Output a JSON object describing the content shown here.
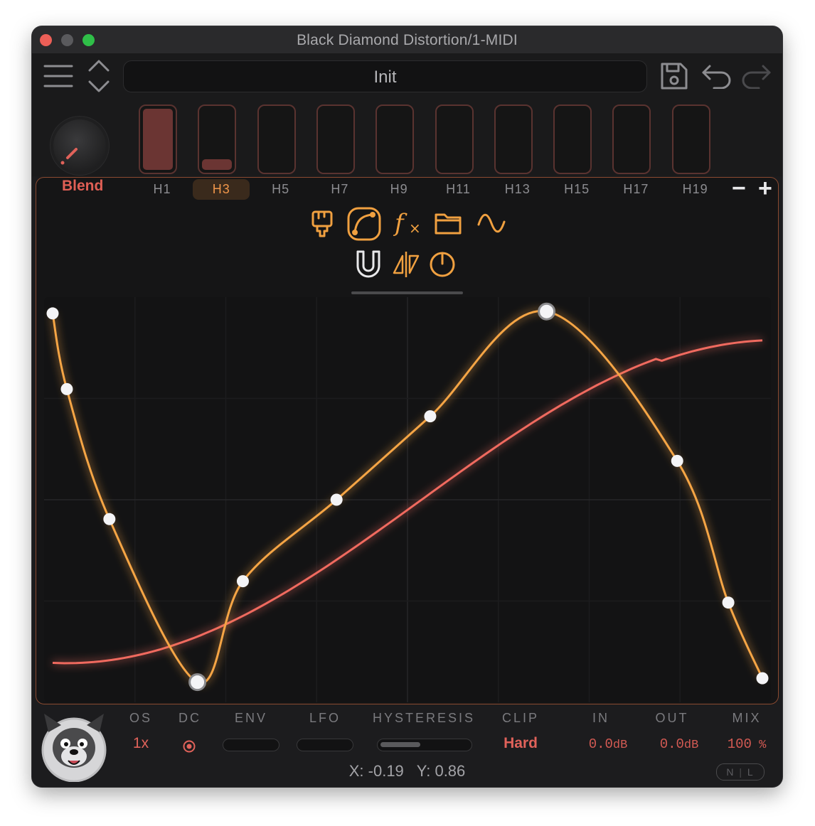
{
  "window": {
    "title": "Black Diamond Distortion/1-MIDI"
  },
  "toolbar": {
    "preset_name": "Init"
  },
  "blend": {
    "label": "Blend"
  },
  "harmonics": {
    "labels": [
      "H1",
      "H3",
      "H5",
      "H7",
      "H9",
      "H11",
      "H13",
      "H15",
      "H17",
      "H19"
    ],
    "active": "H3",
    "levels": [
      1.0,
      0.18,
      0,
      0,
      0,
      0,
      0,
      0,
      0,
      0
    ],
    "minus": "−",
    "plus": "+"
  },
  "tools": {
    "row1": [
      "brush-icon",
      "curve-edit-icon",
      "function-icon",
      "folder-icon",
      "sine-wave-icon"
    ],
    "row2": [
      "magnet-icon",
      "mirror-icon",
      "power-icon"
    ],
    "fx_label": "f",
    "fx_sub": "×"
  },
  "curve": {
    "accent_orange": "#f5a544",
    "accent_red": "#f06a5f",
    "orange_points": [
      [
        -1.0,
        0.96
      ],
      [
        -0.95,
        0.57
      ],
      [
        -0.8,
        -0.1
      ],
      [
        -0.49,
        -0.94
      ],
      [
        -0.33,
        -0.42
      ],
      [
        0.0,
        0.0
      ],
      [
        0.33,
        0.43
      ],
      [
        0.74,
        0.97
      ],
      [
        1.2,
        0.2
      ],
      [
        1.38,
        -0.53
      ],
      [
        1.5,
        -0.92
      ]
    ],
    "red_points": [
      [
        -1.0,
        -0.82
      ],
      [
        0.0,
        0.0
      ],
      [
        1.0,
        0.97
      ]
    ]
  },
  "controls": {
    "os": {
      "label": "OS",
      "value": "1x"
    },
    "dc": {
      "label": "DC"
    },
    "env": {
      "label": "ENV"
    },
    "lfo": {
      "label": "LFO"
    },
    "hysteresis": {
      "label": "HYSTERESIS",
      "level": 0.45
    },
    "clip": {
      "label": "CLIP",
      "value": "Hard"
    },
    "in": {
      "label": "IN",
      "value": "0.0",
      "unit": "dB"
    },
    "out": {
      "label": "OUT",
      "value": "0.0",
      "unit": "dB"
    },
    "mix": {
      "label": "MIX",
      "value": "100",
      "unit": "%"
    }
  },
  "readout": {
    "x_label": "X:",
    "x_value": "-0.19",
    "y_label": "Y:",
    "y_value": "0.86"
  },
  "nl_toggle": {
    "n": "N",
    "l": "L"
  }
}
